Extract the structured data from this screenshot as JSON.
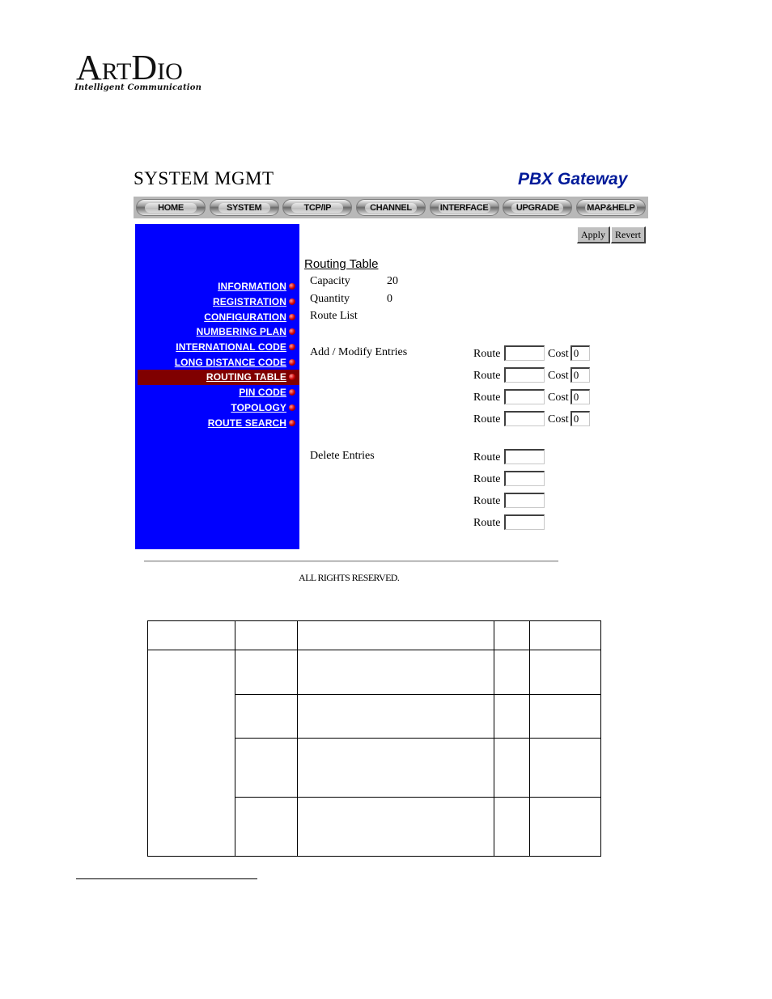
{
  "logo": {
    "brand_prefix": "A",
    "brand_rt": "RT",
    "brand_d": "D",
    "brand_io": "IO",
    "tagline": "Intelligent Communication"
  },
  "header": {
    "section_title": "SYSTEM MGMT",
    "product_title": "PBX Gateway",
    "product_color": "#001a99"
  },
  "nav": {
    "tabs": [
      {
        "label": "HOME"
      },
      {
        "label": "SYSTEM"
      },
      {
        "label": "TCP/IP"
      },
      {
        "label": "CHANNEL"
      },
      {
        "label": "INTERFACE"
      },
      {
        "label": "UPGRADE"
      },
      {
        "label": "MAP&HELP"
      }
    ]
  },
  "sidebar": {
    "background": "#0000ff",
    "active_background": "#800000",
    "items": [
      {
        "label": "INFORMATION",
        "active": false
      },
      {
        "label": "REGISTRATION",
        "active": false
      },
      {
        "label": "CONFIGURATION",
        "active": false
      },
      {
        "label": "NUMBERING PLAN",
        "active": false
      },
      {
        "label": "INTERNATIONAL CODE",
        "active": false
      },
      {
        "label": "LONG DISTANCE CODE",
        "active": false
      },
      {
        "label": "ROUTING TABLE",
        "active": true
      },
      {
        "label": "PIN CODE",
        "active": false
      },
      {
        "label": "TOPOLOGY",
        "active": false
      },
      {
        "label": "ROUTE SEARCH",
        "active": false
      }
    ]
  },
  "actions": {
    "apply_label": "Apply",
    "revert_label": "Revert"
  },
  "main": {
    "title": "Routing Table",
    "capacity_label": "Capacity",
    "capacity_value": "20",
    "quantity_label": "Quantity",
    "quantity_value": "0",
    "route_list_label": "Route List",
    "add_modify_label": "Add / Modify Entries",
    "delete_label": "Delete Entries",
    "route_label": "Route",
    "cost_label": "Cost",
    "add_entries": [
      {
        "route": "",
        "cost": "0"
      },
      {
        "route": "",
        "cost": "0"
      },
      {
        "route": "",
        "cost": "0"
      },
      {
        "route": "",
        "cost": "0"
      }
    ],
    "delete_entries": [
      {
        "route": ""
      },
      {
        "route": ""
      },
      {
        "route": ""
      },
      {
        "route": ""
      }
    ]
  },
  "footer": {
    "rights": "ALL RIGHTS RESERVED."
  }
}
